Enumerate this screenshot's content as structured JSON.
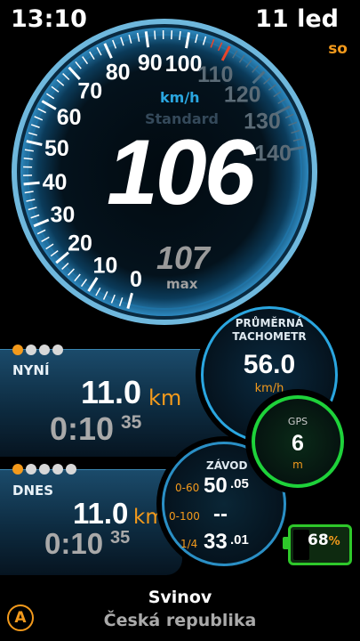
{
  "status": {
    "time": "13:10",
    "date": "11 led",
    "day": "so"
  },
  "speedometer": {
    "unit": "km/h",
    "mode": "Standard",
    "speed": "106",
    "max_value": "107",
    "max_label": "max",
    "ticks": [
      "0",
      "10",
      "20",
      "30",
      "40",
      "50",
      "60",
      "70",
      "80",
      "90",
      "100",
      "110",
      "120",
      "130",
      "140"
    ],
    "value": 106,
    "max_scale": 140
  },
  "average": {
    "label_line1": "PRŮMĚRNÁ",
    "label_line2": "TACHOMETR",
    "value": "56.0",
    "unit": "km/h"
  },
  "now": {
    "label": "NYNÍ",
    "distance": "11.0",
    "distance_unit": "km",
    "time_main": "0:10",
    "time_sec": "35",
    "dots_total": 4,
    "dots_active": 1
  },
  "today": {
    "label": "DNES",
    "distance": "11.0",
    "distance_unit": "km",
    "time_main": "0:10",
    "time_sec": "35",
    "dots_total": 5,
    "dots_active": 1
  },
  "gps": {
    "label": "GPS",
    "value": "6",
    "unit": "m"
  },
  "race": {
    "title": "ZÁVOD",
    "rows": [
      {
        "label": "0-60",
        "main": "50",
        "sub": ".05"
      },
      {
        "label": "0-100",
        "main": "--",
        "sub": ""
      },
      {
        "label": "1/4",
        "main": "33",
        "sub": ".01"
      }
    ]
  },
  "battery": {
    "percent": "68",
    "symbol": "%",
    "level": 0.68
  },
  "location": {
    "city": "Svinov",
    "country": "Česká republika"
  },
  "auto_button": {
    "label": "A"
  },
  "colors": {
    "accent": "#f39a1c",
    "blue": "#2aa6e0",
    "gps_green": "#1ed23a",
    "battery_green": "#2ec82a"
  }
}
